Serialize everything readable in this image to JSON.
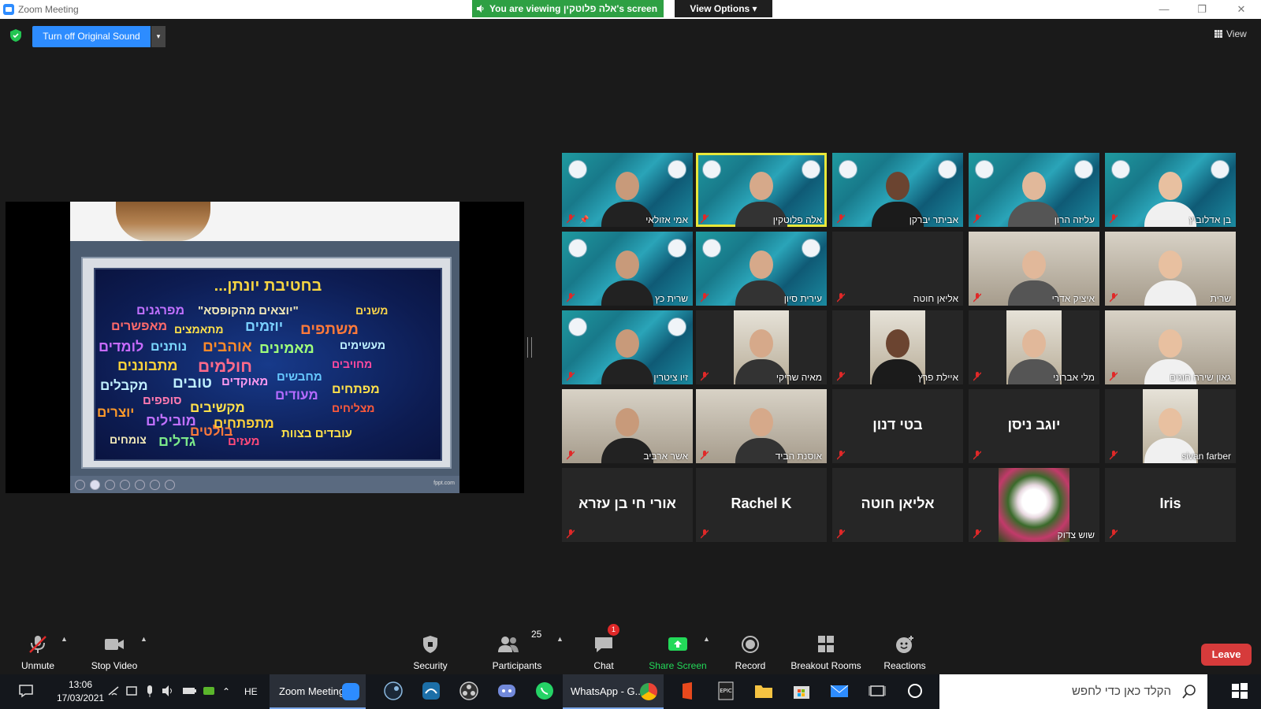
{
  "window": {
    "title": "Zoom Meeting",
    "viewing_text": "You are viewing אלה פלוטקין's screen",
    "view_options": "View Options"
  },
  "top": {
    "original_sound": "Turn off Original Sound",
    "view_label": "View"
  },
  "slide": {
    "heading": "בחטיבת יונתן...",
    "credit": "fppt.com",
    "words": [
      {
        "text": "\"יוצאים מהקופסא\"",
        "color": "#f2e9b8"
      },
      {
        "text": "מפרגנים",
        "color": "#c070ff"
      },
      {
        "text": "משנים",
        "color": "#f7d24a"
      },
      {
        "text": "מאפשרים",
        "color": "#ff6a6a"
      },
      {
        "text": "מתאמצים",
        "color": "#ffe14a"
      },
      {
        "text": "יוזמים",
        "color": "#7ad0ff"
      },
      {
        "text": "משתפים",
        "color": "#ff7a3a"
      },
      {
        "text": "לומדים",
        "color": "#c86bff"
      },
      {
        "text": "נותנים",
        "color": "#7bd8ff"
      },
      {
        "text": "אוהבים",
        "color": "#ff8a2a"
      },
      {
        "text": "מאמינים",
        "color": "#a0ff7a"
      },
      {
        "text": "מעשימים",
        "color": "#bff1ff"
      },
      {
        "text": "מתבוננים",
        "color": "#ffd23a"
      },
      {
        "text": "חולמים",
        "color": "#ff6a8a"
      },
      {
        "text": "מחויבים",
        "color": "#ff4aa0"
      },
      {
        "text": "מחבשים",
        "color": "#66c8ff"
      },
      {
        "text": "מקבלים",
        "color": "#c2f0ff"
      },
      {
        "text": "טובים",
        "color": "#bfefff"
      },
      {
        "text": "מאוקדים",
        "color": "#ff9af0"
      },
      {
        "text": "מעודים",
        "color": "#b46bff"
      },
      {
        "text": "מפתחים",
        "color": "#ffe14a"
      },
      {
        "text": "סופפים",
        "color": "#ff7ab0"
      },
      {
        "text": "מקשיבים",
        "color": "#ffe14a"
      },
      {
        "text": "מצליחים",
        "color": "#ff5a3a"
      },
      {
        "text": "יוצרים",
        "color": "#ff9a2a"
      },
      {
        "text": "מובילים",
        "color": "#c070ff"
      },
      {
        "text": "מתפתחים",
        "color": "#ffd23a"
      },
      {
        "text": "בולטים",
        "color": "#ff7a3a"
      },
      {
        "text": "צומחים",
        "color": "#f2e9b8"
      },
      {
        "text": "גדלים",
        "color": "#7be88a"
      },
      {
        "text": "מעזים",
        "color": "#ff4a7a"
      },
      {
        "text": "עובדים בצוות",
        "color": "#ffe14a"
      }
    ]
  },
  "participants": [
    {
      "name": "אמי אזולאי",
      "style": "bg",
      "active": false,
      "pinned": true
    },
    {
      "name": "אלה פלוטקין",
      "style": "bg",
      "active": true,
      "pinned": false
    },
    {
      "name": "אביתר יברקן",
      "style": "bg",
      "active": false,
      "pinned": false
    },
    {
      "name": "עליזה הרון",
      "style": "bg",
      "active": false,
      "pinned": false
    },
    {
      "name": "בן אדלוביץ",
      "style": "bg",
      "active": false,
      "pinned": false
    },
    {
      "name": "שרית כץ",
      "style": "bg",
      "active": false,
      "pinned": false
    },
    {
      "name": "עירית סיון",
      "style": "bg",
      "active": false,
      "pinned": false
    },
    {
      "name": "אליאן חוטה",
      "style": "off",
      "active": false,
      "pinned": false
    },
    {
      "name": "איציק אדרי",
      "style": "room",
      "active": false,
      "pinned": false
    },
    {
      "name": "שרית",
      "style": "room",
      "active": false,
      "pinned": false
    },
    {
      "name": "זיו ציטרין",
      "style": "bg",
      "active": false,
      "pinned": false
    },
    {
      "name": "מאיה שריקי",
      "style": "cam",
      "active": false,
      "pinned": false
    },
    {
      "name": "איילת פרץ",
      "style": "cam",
      "active": false,
      "pinned": false
    },
    {
      "name": "מלי אברוני",
      "style": "cam",
      "active": false,
      "pinned": false
    },
    {
      "name": "גאון שירה חוגים",
      "style": "room",
      "active": false,
      "pinned": false
    },
    {
      "name": "אשר ארביב",
      "style": "room",
      "active": false,
      "pinned": false
    },
    {
      "name": "אוסנת הביד",
      "style": "room",
      "active": false,
      "pinned": false
    },
    {
      "name": "בטי דנון",
      "style": "text",
      "active": false,
      "pinned": false
    },
    {
      "name": "יוגב ניסן",
      "style": "text",
      "active": false,
      "pinned": false
    },
    {
      "name": "sivan farber",
      "style": "cam",
      "active": false,
      "pinned": false
    },
    {
      "name": "אורי חי בן עזרא",
      "style": "text",
      "active": false,
      "pinned": false
    },
    {
      "name": "Rachel K",
      "style": "text",
      "active": false,
      "pinned": false
    },
    {
      "name": "אליאן חוטה",
      "style": "text",
      "active": false,
      "pinned": false
    },
    {
      "name": "שוש צדוק",
      "style": "flower",
      "active": false,
      "pinned": false
    },
    {
      "name": "Iris",
      "style": "text",
      "active": false,
      "pinned": false
    }
  ],
  "toolbar": {
    "unmute": "Unmute",
    "stop_video": "Stop Video",
    "security": "Security",
    "participants": "Participants",
    "participants_count": "25",
    "chat": "Chat",
    "chat_badge": "1",
    "share_screen": "Share Screen",
    "record": "Record",
    "breakout_rooms": "Breakout Rooms",
    "reactions": "Reactions",
    "leave": "Leave"
  },
  "taskbar": {
    "time": "13:06",
    "date": "17/03/2021",
    "lang": "HE",
    "zoom_app": "Zoom Meeting",
    "whatsapp_app": "WhatsApp - G...",
    "search_placeholder": "הקלד כאן כדי לחפש"
  },
  "colors": {
    "accent": "#2d8cff",
    "viewing_banner": "#2ea043",
    "leave": "#d63b3b",
    "active_speaker": "#e8e83a",
    "mic_off": "#e02828",
    "share_green": "#23d959"
  }
}
